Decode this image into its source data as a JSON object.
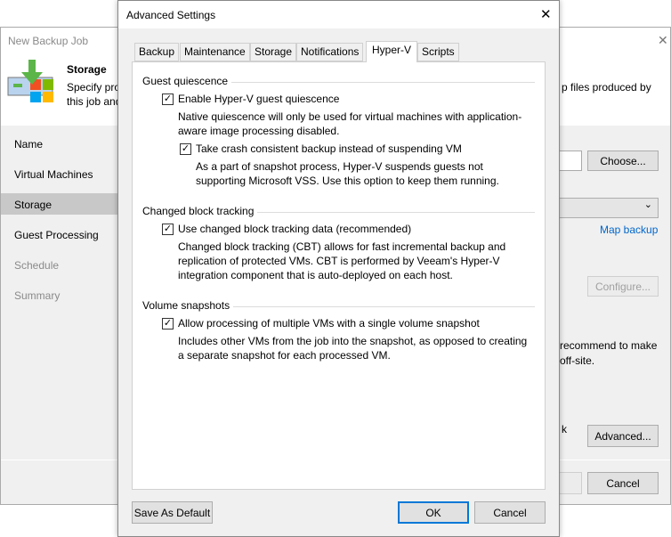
{
  "bg": {
    "title": "New Backup Job",
    "step_title": "Storage",
    "step_desc_1": "Specify pro",
    "step_desc_2": "this job and",
    "right_desc": "p files produced by",
    "nav": [
      "Name",
      "Virtual Machines",
      "Storage",
      "Guest Processing",
      "Schedule",
      "Summary"
    ],
    "choose": "Choose...",
    "map_backup": "Map backup",
    "configure": "Configure...",
    "rec1": "recommend to make",
    "rec2": "off-site.",
    "ck": "k",
    "advanced": "Advanced...",
    "cancel": "Cancel"
  },
  "dlg": {
    "title": "Advanced Settings",
    "tabs": [
      "Backup",
      "Maintenance",
      "Storage",
      "Notifications",
      "Hyper-V",
      "Scripts"
    ],
    "g1": "Guest quiescence",
    "c1": "Enable Hyper-V guest quiescence",
    "d1a": "Native quiescence will only be used for virtual machines with application-",
    "d1b": "aware image processing disabled.",
    "c2": "Take crash consistent backup instead of suspending VM",
    "d2a": "As a part of snapshot process, Hyper-V suspends guests not",
    "d2b": "supporting Microsoft VSS. Use this option to keep them running.",
    "g2": "Changed block tracking",
    "c3": "Use changed block tracking data (recommended)",
    "d3a": "Changed block tracking (CBT) allows for fast incremental backup and",
    "d3b": "replication of protected VMs. CBT is performed by Veeam's Hyper-V",
    "d3c": "integration component that is auto-deployed on each host.",
    "g3": "Volume snapshots",
    "c4": "Allow processing of multiple VMs with a single volume snapshot",
    "d4a": "Includes other VMs from the job into the snapshot, as opposed to creating",
    "d4b": "a separate snapshot for each processed VM.",
    "save_default": "Save As Default",
    "ok": "OK",
    "cancel": "Cancel",
    "check": "✓",
    "close": "✕"
  }
}
